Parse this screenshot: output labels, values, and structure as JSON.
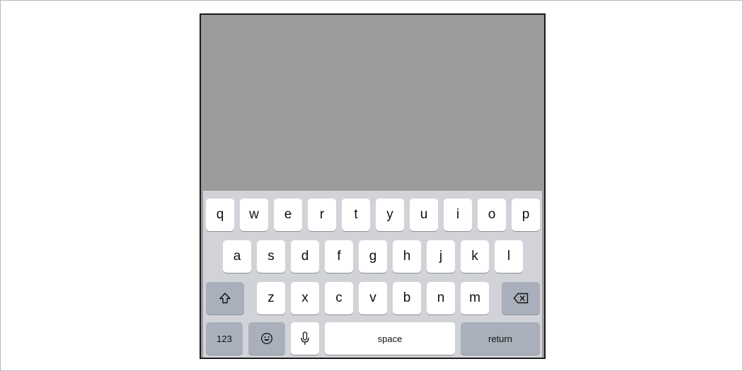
{
  "keyboard": {
    "row1": [
      "q",
      "w",
      "e",
      "r",
      "t",
      "y",
      "u",
      "i",
      "o",
      "p"
    ],
    "row2": [
      "a",
      "s",
      "d",
      "f",
      "g",
      "h",
      "j",
      "k",
      "l"
    ],
    "row3": [
      "z",
      "x",
      "c",
      "v",
      "b",
      "n",
      "m"
    ],
    "shift_icon": "shift-arrow-icon",
    "delete_icon": "backspace-icon",
    "numbers_label": "123",
    "emoji_icon": "smiley-icon",
    "mic_icon": "microphone-icon",
    "space_label": "space",
    "return_label": "return"
  },
  "colors": {
    "screen": "#9b9b9b",
    "keyboard_bg": "#d1d3d8",
    "key_bg": "#ffffff",
    "special_key_bg": "#a9b0bb"
  }
}
